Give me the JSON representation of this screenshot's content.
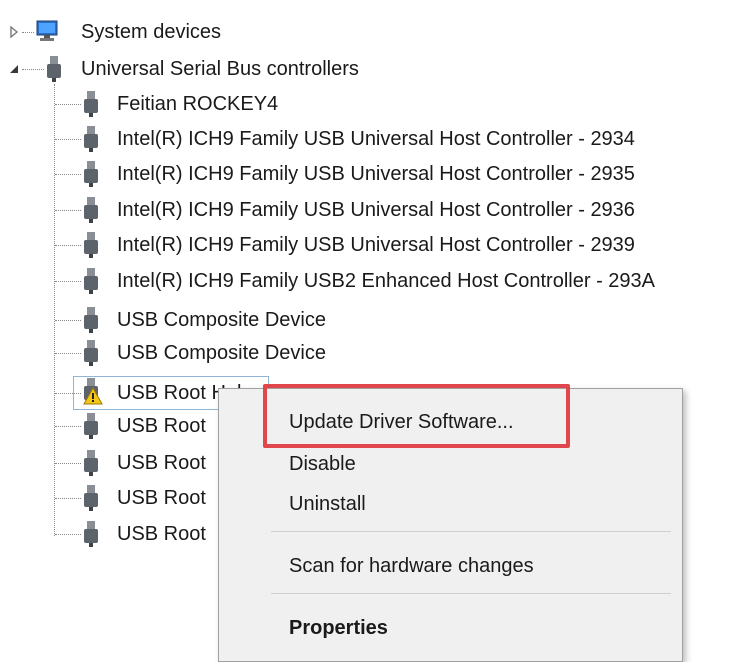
{
  "tree": {
    "system_devices": "System devices",
    "usb_controllers": "Universal Serial Bus controllers",
    "children": [
      "Feitian ROCKEY4",
      "Intel(R) ICH9 Family USB Universal Host Controller - 2934",
      "Intel(R) ICH9 Family USB Universal Host Controller - 2935",
      "Intel(R) ICH9 Family USB Universal Host Controller - 2936",
      "Intel(R) ICH9 Family USB Universal Host Controller - 2939",
      "Intel(R) ICH9 Family USB2 Enhanced Host Controller - 293A",
      "USB Composite Device",
      "USB Composite Device",
      "USB Root Hub",
      "USB Root",
      "USB Root",
      "USB Root",
      "USB Root"
    ]
  },
  "context_menu": {
    "update_driver": "Update Driver Software...",
    "disable": "Disable",
    "uninstall": "Uninstall",
    "scan": "Scan for hardware changes",
    "properties": "Properties"
  },
  "colors": {
    "highlight": "#e0474c",
    "menu_bg": "#f0f0f0",
    "warning": "#f5c518"
  },
  "icons": {
    "system": "monitor-icon",
    "usb": "usb-plug-icon",
    "warning": "warning-icon"
  }
}
